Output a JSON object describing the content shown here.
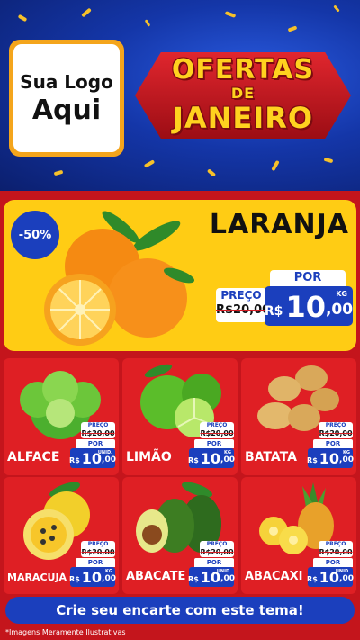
{
  "header": {
    "logo_line1": "Sua Logo",
    "logo_line2": "Aqui",
    "title_line1": "OFERTAS",
    "title_line2": "DE",
    "title_line3": "JANEIRO"
  },
  "hero": {
    "discount": "-50%",
    "name": "LARANJA",
    "por_label": "POR",
    "preco_label": "PREÇO",
    "old_price": "R$20,00",
    "currency": "R$",
    "price_int": "10",
    "price_dec": ",00",
    "unit": "KG"
  },
  "products": [
    {
      "name": "ALFACE",
      "preco_label": "PREÇO",
      "old_price": "R$20,00",
      "por_label": "POR",
      "currency": "R$",
      "price_int": "10",
      "price_dec": ",00",
      "unit": "UNID."
    },
    {
      "name": "LIMÃO",
      "preco_label": "PREÇO",
      "old_price": "R$20,00",
      "por_label": "POR",
      "currency": "R$",
      "price_int": "10",
      "price_dec": ",00",
      "unit": "KG"
    },
    {
      "name": "BATATA",
      "preco_label": "PREÇO",
      "old_price": "R$20,00",
      "por_label": "POR",
      "currency": "R$",
      "price_int": "10",
      "price_dec": ",00",
      "unit": "KG"
    },
    {
      "name": "MARACUJÁ",
      "preco_label": "PREÇO",
      "old_price": "R$20,00",
      "por_label": "POR",
      "currency": "R$",
      "price_int": "10",
      "price_dec": ",00",
      "unit": "KG"
    },
    {
      "name": "ABACATE",
      "preco_label": "PREÇO",
      "old_price": "R$20,00",
      "por_label": "POR",
      "currency": "R$",
      "price_int": "10",
      "price_dec": ",00",
      "unit": "UNID."
    },
    {
      "name": "ABACAXI",
      "preco_label": "PREÇO",
      "old_price": "R$20,00",
      "por_label": "POR",
      "currency": "R$",
      "price_int": "10",
      "price_dec": ",00",
      "unit": "UNID."
    }
  ],
  "footer": {
    "cta": "Crie seu encarte com este tema!",
    "disclaimer": "*Imagens Meramente Ilustrativas"
  },
  "colors": {
    "brand_blue": "#1b3fbd",
    "brand_red": "#df1f24",
    "brand_yellow": "#ffcc14"
  }
}
